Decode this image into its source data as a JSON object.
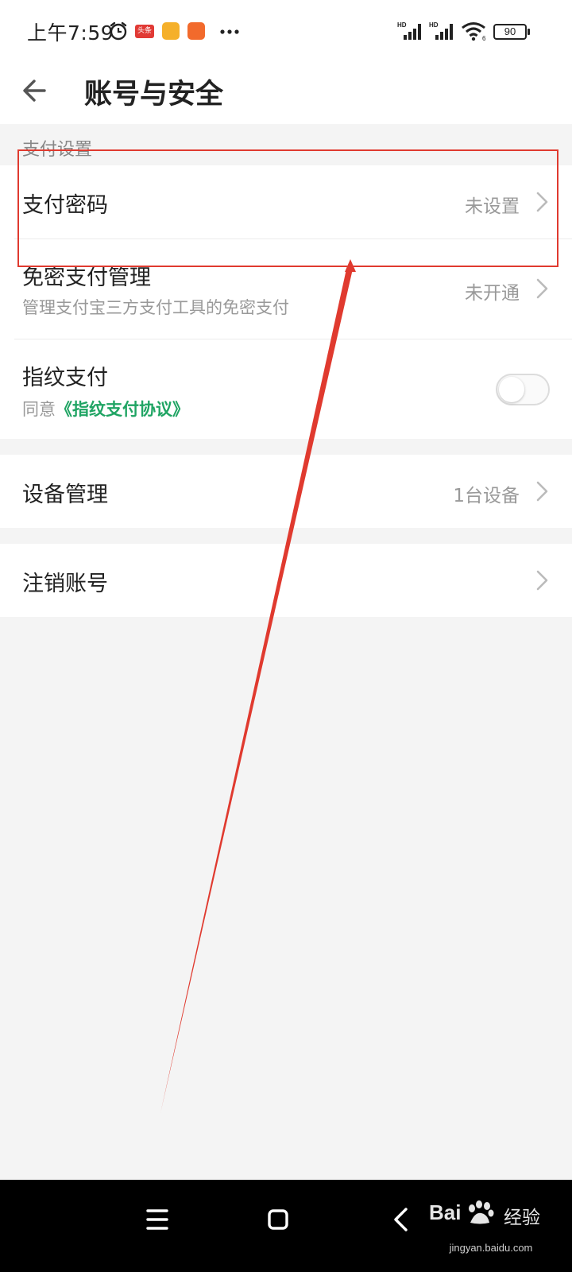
{
  "status": {
    "time": "上午7:59",
    "battery": "90",
    "app_badge": "头条"
  },
  "header": {
    "title": "账号与安全"
  },
  "payment_section": {
    "label": "支付设置",
    "rows": [
      {
        "title": "支付密码",
        "value": "未设置"
      },
      {
        "title": "免密支付管理",
        "subtitle": "管理支付宝三方支付工具的免密支付",
        "value": "未开通"
      },
      {
        "title": "指纹支付",
        "subtitle_prefix": "同意",
        "subtitle_link": "《指纹支付协议》",
        "toggle_on": false
      }
    ]
  },
  "device": {
    "title": "设备管理",
    "value": "1台设备"
  },
  "cancel": {
    "title": "注销账号"
  },
  "watermark": {
    "brand": "Bai",
    "suffix": "经验",
    "url": "jingyan.baidu.com"
  },
  "colors": {
    "accent_green": "#1fa463",
    "highlight_red": "#e03a2f"
  }
}
